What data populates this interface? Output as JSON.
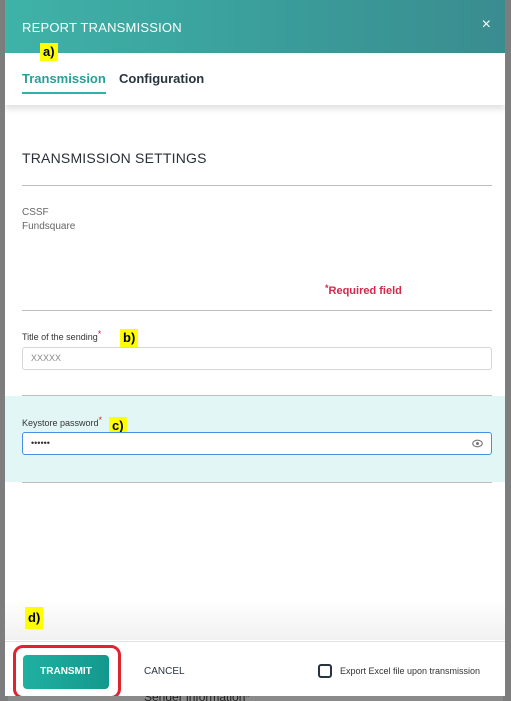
{
  "dialog": {
    "title": "REPORT TRANSMISSION",
    "close_icon": "×"
  },
  "tabs": [
    {
      "label": "Transmission",
      "active": true
    },
    {
      "label": "Configuration",
      "active": false
    }
  ],
  "annotations": {
    "a": "a)",
    "b": "b)",
    "c": "c)",
    "d": "d)"
  },
  "section": {
    "title": "TRANSMISSION SETTINGS",
    "providers": [
      "CSSF",
      "Fundsquare"
    ],
    "required_marker": "*",
    "required_text": "Required field"
  },
  "fields": {
    "title_label": "Title of the sending",
    "title_value": "XXXXX",
    "keystore_label": "Keystore password",
    "keystore_value": "••••••",
    "required_star": "*"
  },
  "footer": {
    "transmit_label": "TRANSMIT",
    "cancel_label": "CANCEL",
    "export_checkbox_checked": false,
    "export_label": "Export Excel file upon transmission"
  },
  "background": {
    "partial_text": "Sender information*"
  },
  "colors": {
    "accent": "#2db3a8",
    "required": "#d0294b",
    "highlight": "#e0242f",
    "annotation": "#ffff00"
  }
}
